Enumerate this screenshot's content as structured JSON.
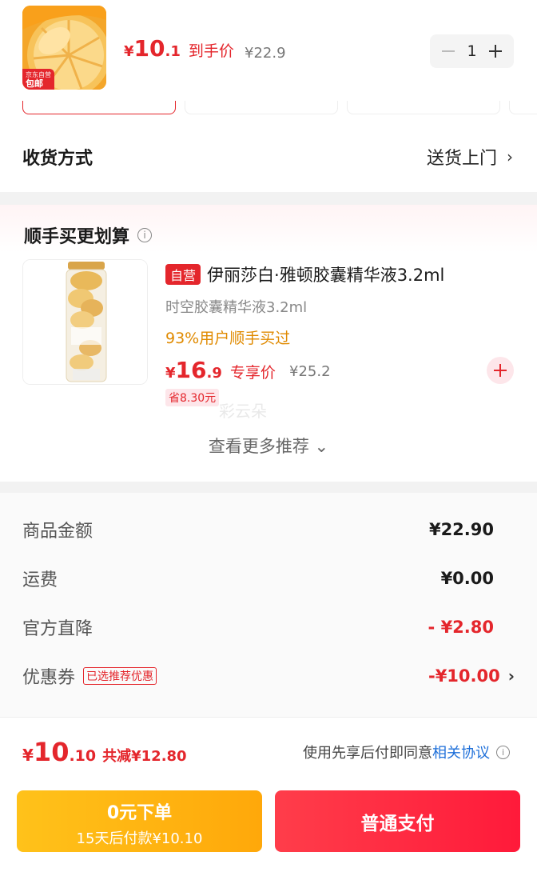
{
  "product": {
    "badge_top": "京东自营",
    "badge_main": "包邮",
    "price_currency": "¥",
    "price_int": "10",
    "price_dec": ".1",
    "price_tag": "到手价",
    "original_price": "¥22.9",
    "quantity": "1",
    "minus_icon": "minus-icon",
    "plus_icon": "plus-icon"
  },
  "delivery": {
    "label": "收货方式",
    "value": "送货上门",
    "chevron": "›"
  },
  "reco": {
    "title": "顺手买更划算",
    "info_glyph": "i",
    "item": {
      "tag": "自营",
      "name": "伊丽莎白·雅顿胶囊精华液3.2ml",
      "sub": "时空胶囊精华液3.2ml",
      "bought": "93%用户顺手买过",
      "price_currency": "¥",
      "price_int": "16",
      "price_dec": ".9",
      "price_tag": "专享价",
      "original_price": "¥25.2",
      "save": "省8.30元",
      "add_glyph": "+"
    },
    "watermark": "彩云朵",
    "more": "查看更多推荐 ⌄"
  },
  "summary": {
    "rows": [
      {
        "label": "商品金额",
        "value": "¥22.90"
      },
      {
        "label": "运费",
        "value": "¥0.00"
      },
      {
        "label": "官方直降",
        "value": "- ¥2.80"
      },
      {
        "label": "优惠券",
        "tag": "已选推荐优惠",
        "value": "-¥10.00",
        "chevron": "›"
      }
    ]
  },
  "footer": {
    "total_currency": "¥",
    "total_int": "10",
    "total_dec": ".10",
    "saved": "共减¥12.80",
    "agree_text": "使用先享后付即同意",
    "agree_link": "相关协议",
    "pay_later_line1": "0元下单",
    "pay_later_line2": "15天后付款¥10.10",
    "pay_now": "普通支付"
  },
  "colors": {
    "accent_red": "#e4262c",
    "link_blue": "#1e6fd9",
    "pay_later_yellow": "#ffb612",
    "pay_now_red": "#ff2a40"
  }
}
